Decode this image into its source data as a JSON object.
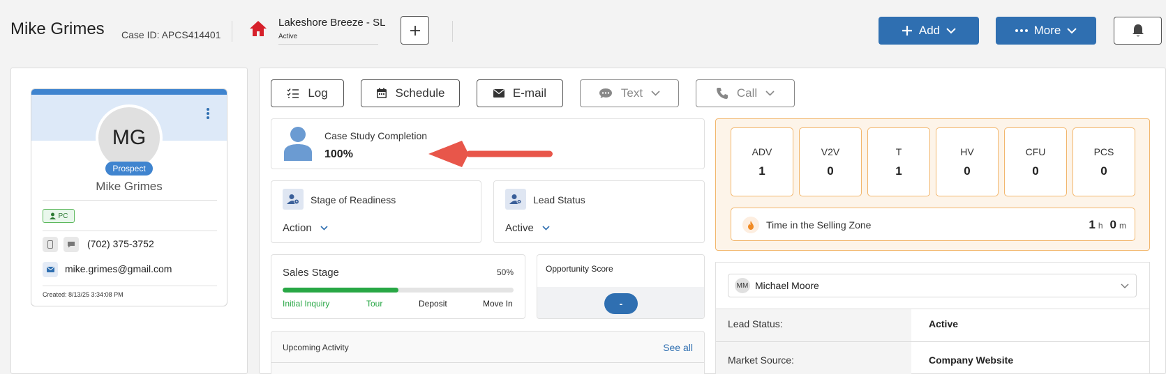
{
  "header": {
    "name": "Mike Grimes",
    "case_id": "Case ID: APCS414401",
    "community": "Lakeshore Breeze - SL",
    "community_status": "Active",
    "add_label": "Add",
    "more_label": "More"
  },
  "profile": {
    "initials": "MG",
    "badge": "Prospect",
    "name": "Mike Grimes",
    "tag": "PC",
    "phone": "(702) 375-3752",
    "email": "mike.grimes@gmail.com",
    "created": "Created: 8/13/25 3:34:08 PM"
  },
  "actions": [
    {
      "label": "Log",
      "icon": "checklist-icon",
      "enabled": true
    },
    {
      "label": "Schedule",
      "icon": "calendar-icon",
      "enabled": true
    },
    {
      "label": "E-mail",
      "icon": "envelope-icon",
      "enabled": true
    },
    {
      "label": "Text",
      "icon": "chat-icon",
      "enabled": false
    },
    {
      "label": "Call",
      "icon": "phone-icon",
      "enabled": false
    }
  ],
  "case_study": {
    "title": "Case Study Completion",
    "value": "100%"
  },
  "stage_readiness": {
    "title": "Stage of Readiness",
    "value": "Action"
  },
  "lead_status_box": {
    "title": "Lead Status",
    "value": "Active"
  },
  "sales_stage": {
    "title": "Sales Stage",
    "percent_label": "50%",
    "progress": 0.5,
    "steps": [
      "Initial Inquiry",
      "Tour",
      "Deposit",
      "Move In"
    ]
  },
  "opportunity": {
    "title": "Opportunity Score",
    "value": "-"
  },
  "upcoming": {
    "title": "Upcoming Activity",
    "link": "See all"
  },
  "metrics": [
    {
      "label": "ADV",
      "value": "1"
    },
    {
      "label": "V2V",
      "value": "0"
    },
    {
      "label": "T",
      "value": "1"
    },
    {
      "label": "HV",
      "value": "0"
    },
    {
      "label": "CFU",
      "value": "0"
    },
    {
      "label": "PCS",
      "value": "0"
    }
  ],
  "selling_zone": {
    "label": "Time in the Selling Zone",
    "hours": "1",
    "h": "h",
    "minutes": "0",
    "m": "m"
  },
  "owner": {
    "initials": "MM",
    "name": "Michael Moore"
  },
  "details": [
    {
      "label": "Lead Status:",
      "value": "Active"
    },
    {
      "label": "Market Source:",
      "value": "Company Website"
    }
  ],
  "colors": {
    "primary": "#2f6fb1",
    "accent_orange": "#f2b66c",
    "progress_green": "#28a745",
    "arrow_red": "#e8564a"
  }
}
